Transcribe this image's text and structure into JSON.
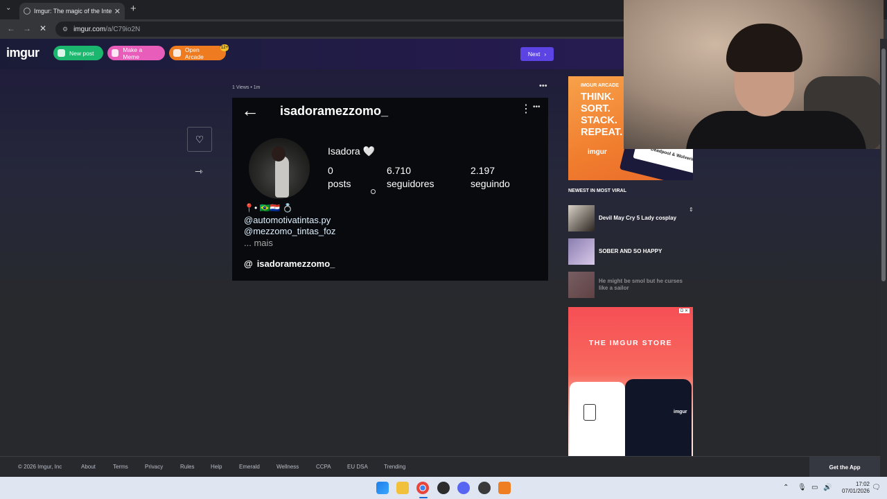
{
  "browser": {
    "tab_title": "Imgur: The magic of the Interne",
    "url_host": "imgur.com",
    "url_path": "/a/C79io2N",
    "tab_close": "✕",
    "new_tab": "+",
    "tab_dropdown": "⌄"
  },
  "header": {
    "logo": "imgur",
    "new_post": "New post",
    "make_meme": "Make a Meme",
    "open_arcade": "Open Arcade",
    "arcade_badge": "12+",
    "next": "Next"
  },
  "post": {
    "meta": "1 Views • 1m",
    "ig": {
      "username": "isadoramezzomo_",
      "name": "Isadora 🤍",
      "stats": [
        {
          "value": "0",
          "label": "posts"
        },
        {
          "value": "6.710",
          "label": "seguidores"
        },
        {
          "value": "2.197",
          "label": "seguindo"
        }
      ],
      "bio_line": "📍• 🇧🇷🇵🇾 💍",
      "link1": "@automotivatintas.py",
      "link2": "@mezzomo_tintas_foz",
      "more": "... mais",
      "threads": "isadoramezzomo_"
    }
  },
  "sidebar": {
    "arcade_ad": {
      "label": "IMGUR ARCADE",
      "headline_1": "THINK.",
      "headline_2": "SORT.",
      "headline_3": "STACK.",
      "headline_4": "REPEAT.",
      "brand": "imgur",
      "card": "Deadpool & Wolverine"
    },
    "viral_title": "NEWEST IN MOST VIRAL",
    "viral_items": [
      {
        "title": "Devil May Cry 5 Lady cosplay"
      },
      {
        "title": "SOBER AND SO HAPPY"
      },
      {
        "title": "He might be smol but he curses like a sailor"
      }
    ],
    "store_ad": {
      "title": "THE IMGUR STORE",
      "tee_logo": "imgur",
      "ad_chip": "D ✕"
    }
  },
  "footer": {
    "copyright": "© 2026 Imgur, Inc",
    "links": [
      "About",
      "Terms",
      "Privacy",
      "Rules",
      "Help",
      "Emerald",
      "Wellness",
      "CCPA",
      "EU DSA",
      "Trending"
    ],
    "get_app": "Get the App"
  },
  "taskbar": {
    "time": "17:02",
    "date": "07/01/2026"
  }
}
